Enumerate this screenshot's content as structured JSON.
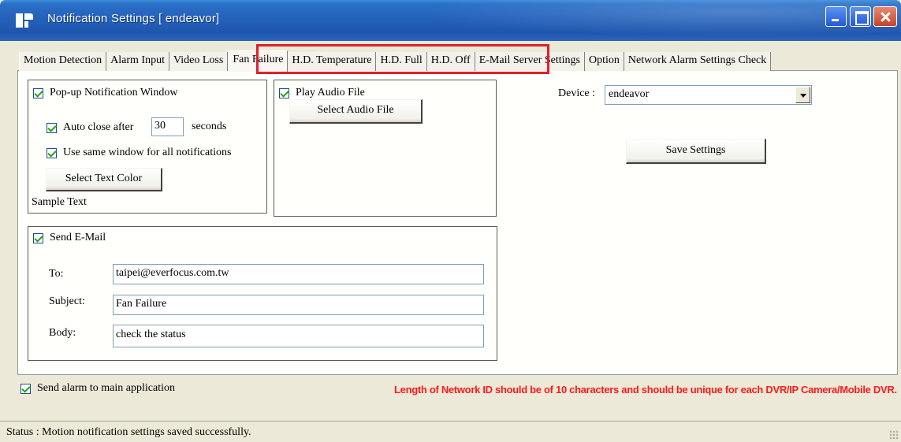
{
  "window": {
    "title": "Notification Settings  [ endeavor]"
  },
  "tabs": [
    {
      "label": "Motion Detection"
    },
    {
      "label": "Alarm Input"
    },
    {
      "label": "Video Loss"
    },
    {
      "label": "Fan Failure",
      "active": true
    },
    {
      "label": "H.D. Temperature"
    },
    {
      "label": "H.D. Full"
    },
    {
      "label": "H.D. Off"
    },
    {
      "label": "E-Mail Server Settings"
    },
    {
      "label": "Option"
    },
    {
      "label": "Network Alarm Settings Check"
    }
  ],
  "popup": {
    "label": "Pop-up Notification Window",
    "checked": true,
    "auto_close_label": "Auto close after",
    "auto_close_value": "30",
    "seconds_label": "seconds",
    "same_window_label": "Use same window for all notifications",
    "select_color_button": "Select Text Color",
    "sample_text": "Sample Text"
  },
  "audio": {
    "label": "Play Audio File",
    "select_button": "Select Audio File"
  },
  "email": {
    "label": "Send E-Mail",
    "to_label": "To:",
    "to_value": "taipei@everfocus.com.tw",
    "subject_label": "Subject:",
    "subject_value": "Fan Failure",
    "body_label": "Body:",
    "body_value": "check the status"
  },
  "device": {
    "label": "Device :",
    "value": "endeavor"
  },
  "save_button": "Save Settings",
  "send_alarm_label": "Send alarm to main application",
  "warning": "Length of Network ID should be of 10 characters and should be unique for each DVR/IP Camera/Mobile DVR.",
  "status": "Status : Motion notification settings saved successfully.",
  "colors": {
    "highlight": "#e01f2a",
    "warning": "#ff1a1a",
    "titlebar": "#2461ba"
  }
}
